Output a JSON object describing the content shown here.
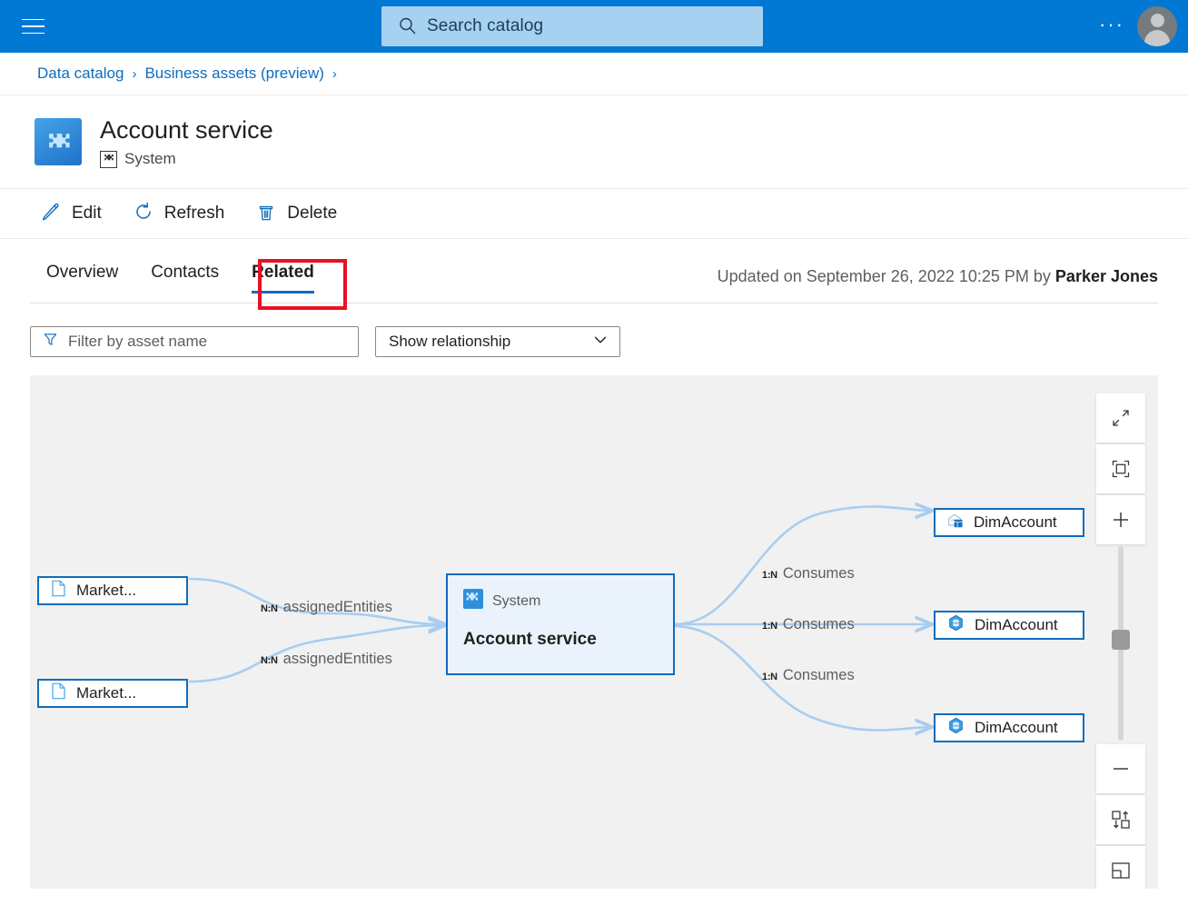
{
  "topbar": {
    "menu_icon": "hamburger-icon",
    "search": {
      "placeholder": "Search catalog",
      "icon": "search-icon"
    },
    "more_icon": "ellipsis-icon",
    "account_icon": "avatar-icon",
    "background_color": "#0078d4"
  },
  "breadcrumb": {
    "items": [
      {
        "label": "Data catalog"
      },
      {
        "label": "Business assets (preview)"
      }
    ],
    "separator": "›"
  },
  "header": {
    "icon": "system-puzzle-icon",
    "title": "Account service",
    "type_icon": "system-outline-icon",
    "type_label": "System"
  },
  "commandbar": {
    "items": [
      {
        "label": "Edit",
        "icon": "pencil-icon"
      },
      {
        "label": "Refresh",
        "icon": "refresh-icon"
      },
      {
        "label": "Delete",
        "icon": "trash-icon"
      }
    ]
  },
  "tabs": {
    "items": [
      {
        "label": "Overview",
        "active": false
      },
      {
        "label": "Contacts",
        "active": false
      },
      {
        "label": "Related",
        "active": true
      }
    ],
    "highlight_color": "#e81123",
    "active_underline_color": "#0f6cbd"
  },
  "updated": {
    "prefix": "Updated on September 26, 2022 10:25 PM by ",
    "user": "Parker Jones"
  },
  "filters": {
    "filter_input": {
      "placeholder": "Filter by asset name",
      "icon": "funnel-icon",
      "value": ""
    },
    "relationship_select": {
      "selected": "Show relationship",
      "icon": "chevron-down-icon"
    }
  },
  "graph": {
    "background_color": "#f1f1f1",
    "node_border_color": "#0f6cbd",
    "edge_color": "#a9cdf0",
    "nodes": [
      {
        "id": "left1",
        "label": "Market...",
        "icon": "document-icon",
        "kind": "asset"
      },
      {
        "id": "left2",
        "label": "Market...",
        "icon": "document-icon",
        "kind": "asset"
      },
      {
        "id": "center",
        "type_label": "System",
        "label": "Account service",
        "icon": "system-puzzle-icon",
        "kind": "focus"
      },
      {
        "id": "right1",
        "label": "DimAccount",
        "icon": "warehouse-table-icon",
        "kind": "asset"
      },
      {
        "id": "right2",
        "label": "DimAccount",
        "icon": "hexagon-db-icon",
        "kind": "asset"
      },
      {
        "id": "right3",
        "label": "DimAccount",
        "icon": "hexagon-db-icon",
        "kind": "asset"
      }
    ],
    "edges": [
      {
        "cardinality": "N:N",
        "name": "assignedEntities",
        "from": "left1",
        "to": "center"
      },
      {
        "cardinality": "N:N",
        "name": "assignedEntities",
        "from": "left2",
        "to": "center"
      },
      {
        "cardinality": "1:N",
        "name": "Consumes",
        "from": "center",
        "to": "right1"
      },
      {
        "cardinality": "1:N",
        "name": "Consumes",
        "from": "center",
        "to": "right2"
      },
      {
        "cardinality": "1:N",
        "name": "Consumes",
        "from": "center",
        "to": "right3"
      }
    ],
    "toolbar": [
      {
        "name": "expand-icon",
        "title": "Expand"
      },
      {
        "name": "fit-to-screen-icon",
        "title": "Fit to screen"
      },
      {
        "name": "zoom-in-icon",
        "title": "Zoom in"
      },
      {
        "name": "zoom-out-icon",
        "title": "Zoom out"
      },
      {
        "name": "swap-layout-icon",
        "title": "Change layout direction"
      },
      {
        "name": "panel-layout-icon",
        "title": "Toggle panel"
      }
    ]
  }
}
